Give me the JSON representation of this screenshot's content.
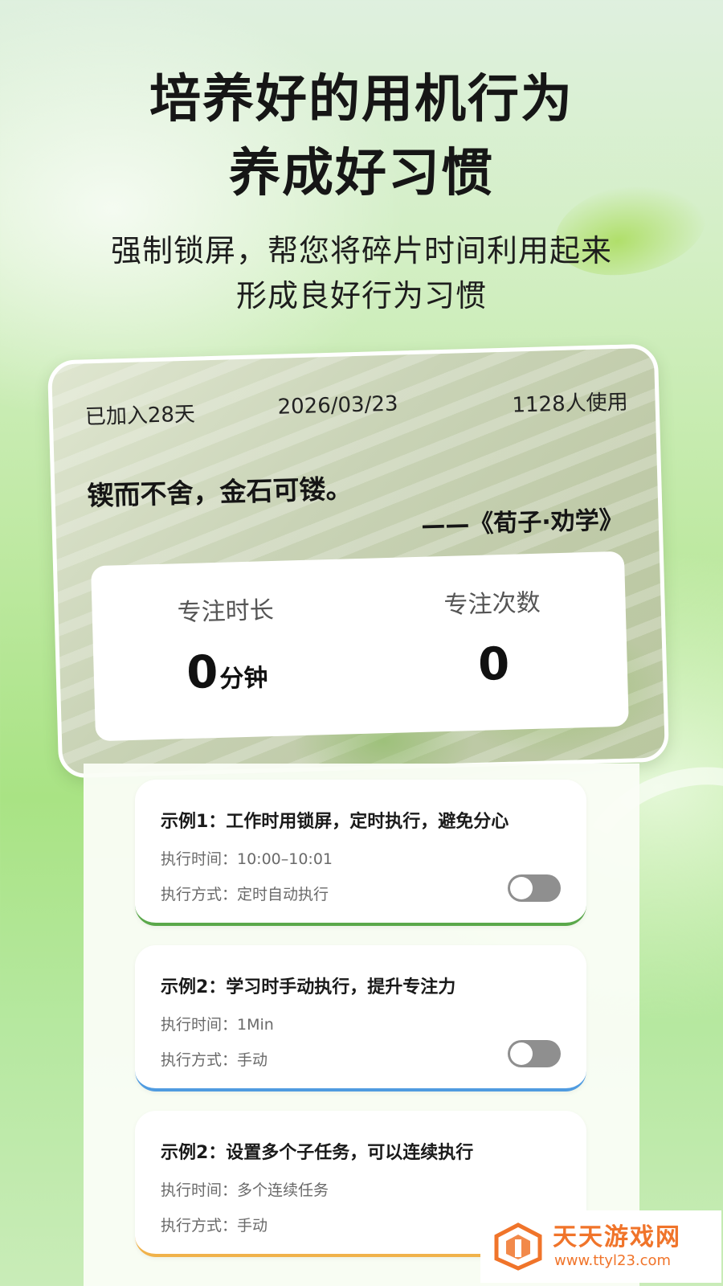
{
  "headline": {
    "line1": "培养好的用机行为",
    "line2": "养成好习惯"
  },
  "subline": {
    "line1": "强制锁屏，帮您将碎片时间利用起来",
    "line2": "形成良好行为习惯"
  },
  "hero": {
    "joined": "已加入28天",
    "date": "2026/03/23",
    "users": "1128人使用",
    "quote": "锲而不舍，金石可镂。",
    "source": "——《荀子·劝学》"
  },
  "stats": {
    "duration_label": "专注时长",
    "duration_value": "0",
    "duration_unit": "分钟",
    "count_label": "专注次数",
    "count_value": "0"
  },
  "tasks": [
    {
      "title": "示例1：工作时用锁屏，定时执行，避免分心",
      "time": "执行时间：10:00–10:01",
      "mode": "执行方式：定时自动执行",
      "accent": "#5aa84a",
      "toggle_on": false
    },
    {
      "title": "示例2：学习时手动执行，提升专注力",
      "time": "执行时间：1Min",
      "mode": "执行方式：手动",
      "accent": "#4f9be0",
      "toggle_on": false
    },
    {
      "title": "示例2：设置多个子任务，可以连续执行",
      "time": "执行时间：多个连续任务",
      "mode": "执行方式：手动",
      "accent": "#f0b24a"
    }
  ],
  "watermark": {
    "name": "天天游戏网",
    "url": "www.ttyl23.com",
    "color": "#f0742a"
  }
}
